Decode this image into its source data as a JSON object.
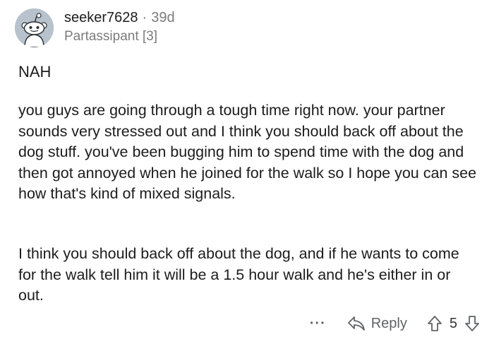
{
  "comment": {
    "username": "seeker7628",
    "separator": "·",
    "age": "39d",
    "flair": "Partassipant [3]",
    "verdict": "NAH",
    "paragraphs": [
      "you guys are going through a tough time right now. your partner sounds very stressed out and I think you should back off about the dog stuff. you've been bugging him to spend time with the dog and then got annoyed when he joined for the walk so I hope you can see how that's kind of mixed signals.",
      "I think you should back off about the dog, and if he wants to come for the walk tell him it will be a 1.5 hour walk and he's either in or out."
    ]
  },
  "actions": {
    "more_label": "···",
    "reply_label": "Reply",
    "vote_count": "5",
    "icons": [
      "reply-arrow-icon",
      "upvote-icon",
      "downvote-icon"
    ]
  },
  "colors": {
    "text": "#1c1c1c",
    "muted": "#7c7c7c",
    "avatar_bg": "#b8c2cc"
  }
}
